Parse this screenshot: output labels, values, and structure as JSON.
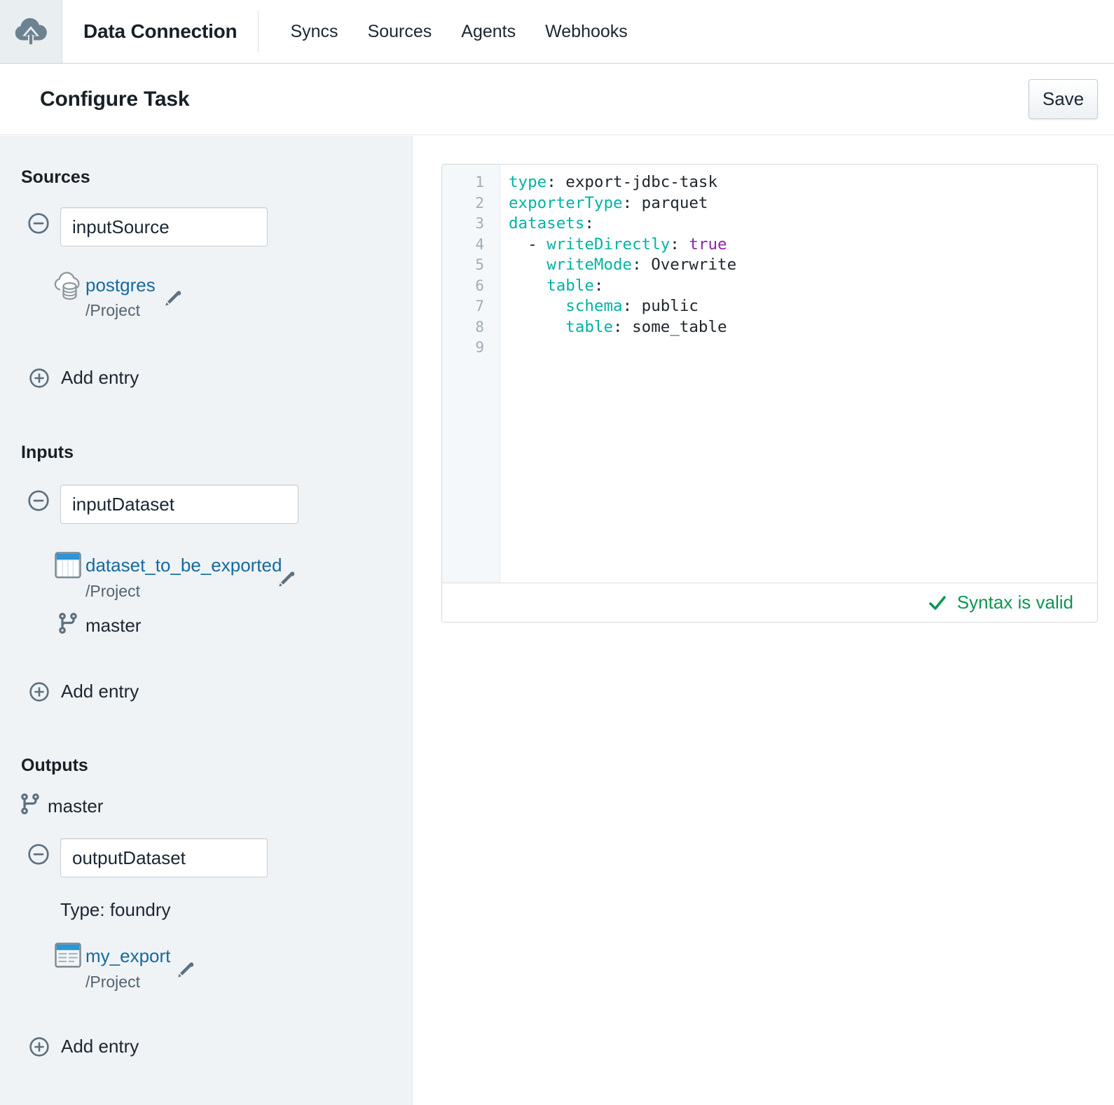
{
  "navbar": {
    "logo_icon": "cloud-upload-icon",
    "app_title": "Data Connection",
    "items": [
      {
        "label": "Syncs"
      },
      {
        "label": "Sources"
      },
      {
        "label": "Agents"
      },
      {
        "label": "Webhooks"
      }
    ]
  },
  "page_header": {
    "title": "Configure Task",
    "save_button": "Save"
  },
  "sidebar": {
    "sources": {
      "heading": "Sources",
      "entry": {
        "name_value": "inputSource",
        "resource_icon": "source-cloud-database-icon",
        "resource_name": "postgres",
        "resource_path": "/Project"
      },
      "add_entry_label": "Add entry"
    },
    "inputs": {
      "heading": "Inputs",
      "entry": {
        "name_value": "inputDataset",
        "resource_icon": "dataset-table-icon",
        "resource_name": "dataset_to_be_exported",
        "resource_path": "/Project",
        "branch": "master"
      },
      "add_entry_label": "Add entry"
    },
    "outputs": {
      "heading": "Outputs",
      "branch": "master",
      "entry": {
        "name_value": "outputDataset",
        "type_label": "Type: foundry",
        "resource_icon": "export-document-icon",
        "resource_name": "my_export",
        "resource_path": "/Project"
      },
      "add_entry_label": "Add entry"
    }
  },
  "editor": {
    "language": "yaml",
    "lines": [
      [
        {
          "t": "key",
          "v": "type"
        },
        {
          "t": "plain",
          "v": ": export-jdbc-task"
        }
      ],
      [
        {
          "t": "key",
          "v": "exporterType"
        },
        {
          "t": "plain",
          "v": ": parquet"
        }
      ],
      [
        {
          "t": "key",
          "v": "datasets"
        },
        {
          "t": "plain",
          "v": ":"
        }
      ],
      [
        {
          "t": "plain",
          "v": "  - "
        },
        {
          "t": "key",
          "v": "writeDirectly"
        },
        {
          "t": "plain",
          "v": ": "
        },
        {
          "t": "bool",
          "v": "true"
        }
      ],
      [
        {
          "t": "plain",
          "v": "    "
        },
        {
          "t": "key",
          "v": "writeMode"
        },
        {
          "t": "plain",
          "v": ": Overwrite"
        }
      ],
      [
        {
          "t": "plain",
          "v": "    "
        },
        {
          "t": "key",
          "v": "table"
        },
        {
          "t": "plain",
          "v": ":"
        }
      ],
      [
        {
          "t": "plain",
          "v": "      "
        },
        {
          "t": "key",
          "v": "schema"
        },
        {
          "t": "plain",
          "v": ": public"
        }
      ],
      [
        {
          "t": "plain",
          "v": "      "
        },
        {
          "t": "key",
          "v": "table"
        },
        {
          "t": "plain",
          "v": ": some_table"
        }
      ],
      []
    ],
    "status": {
      "icon": "check-icon",
      "label": "Syntax is valid",
      "color": "#0d9552"
    },
    "colors": {
      "key": "#00b3a4",
      "boolean": "#8f24aa",
      "text": "#1f262d",
      "line_number": "#9fadb8",
      "link_blue": "#17699e",
      "slate_icon": "#5c7080"
    }
  }
}
